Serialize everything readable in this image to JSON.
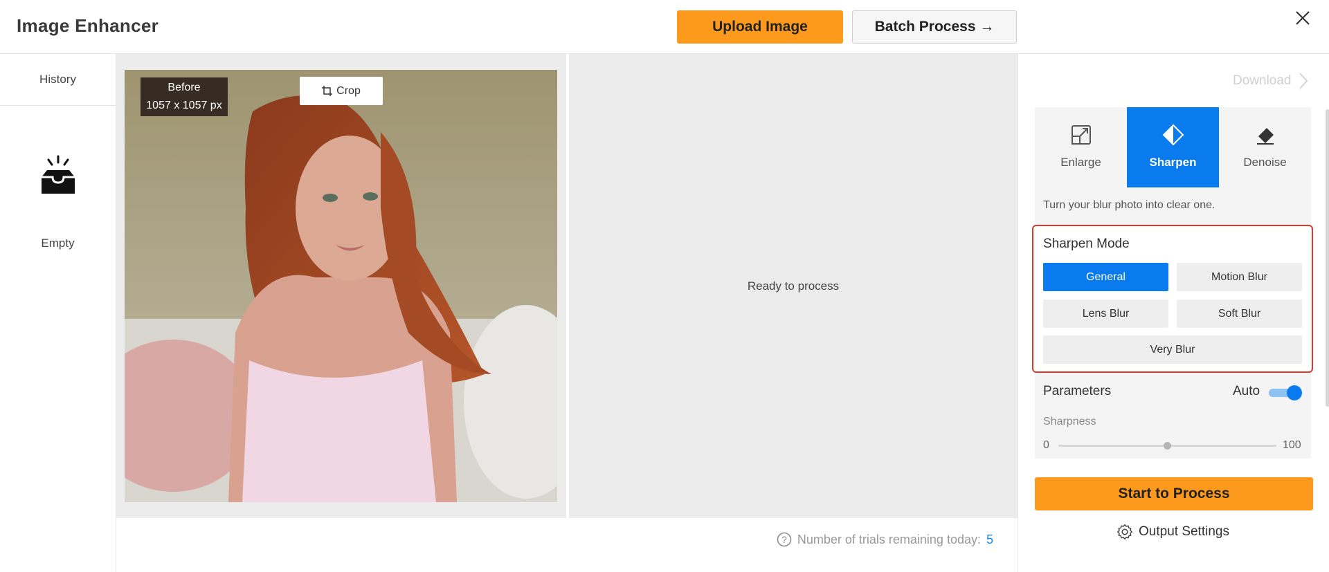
{
  "header": {
    "title": "Image Enhancer",
    "upload_label": "Upload Image",
    "batch_label": "Batch Process →",
    "close_icon": "close-icon"
  },
  "sidebar": {
    "history_label": "History",
    "empty_icon": "empty-inbox-icon",
    "empty_label": "Empty"
  },
  "workspace": {
    "before_label": "Before",
    "image_size": "1057 x 1057 px",
    "crop_label": "Crop",
    "ready_text": "Ready to process",
    "trials_label": "Number of trials remaining today:",
    "trials_count": "5"
  },
  "right_panel": {
    "download_label": "Download",
    "mode_tabs": [
      {
        "label": "Enlarge",
        "icon": "enlarge-icon",
        "active": false
      },
      {
        "label": "Sharpen",
        "icon": "sharpen-icon",
        "active": true
      },
      {
        "label": "Denoise",
        "icon": "eraser-icon",
        "active": false
      }
    ],
    "mode_description": "Turn your blur photo into clear one.",
    "sharpen_mode_title": "Sharpen Mode",
    "sharpen_options": [
      {
        "label": "General",
        "active": true
      },
      {
        "label": "Motion Blur",
        "active": false
      },
      {
        "label": "Lens Blur",
        "active": false
      },
      {
        "label": "Soft Blur",
        "active": false
      },
      {
        "label": "Very Blur",
        "active": false
      }
    ],
    "parameters_title": "Parameters",
    "auto_label": "Auto",
    "auto_enabled": true,
    "sharpness_label": "Sharpness",
    "sharpness_min": "0",
    "sharpness_max": "100",
    "sharpness_value": 50,
    "start_label": "Start to Process",
    "output_settings_label": "Output Settings"
  },
  "colors": {
    "accent_orange": "#fd9a1e",
    "accent_blue": "#0a7aef",
    "highlight_red": "#d93a2b"
  }
}
